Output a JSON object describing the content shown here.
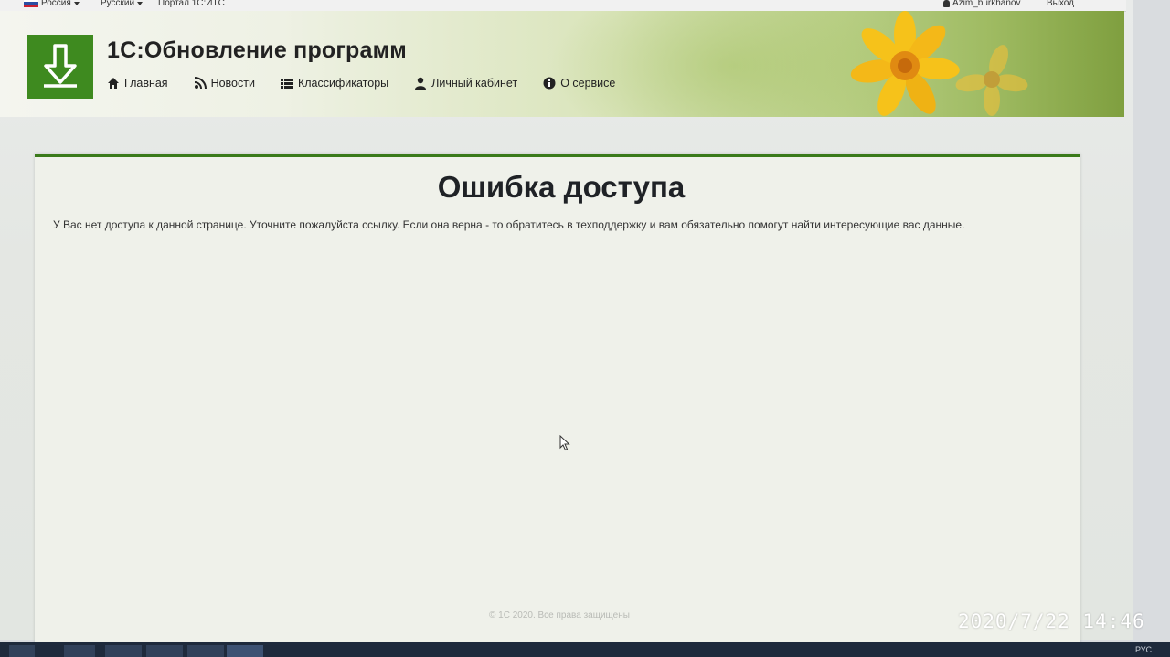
{
  "topbar": {
    "region": "Россия",
    "language": "Русский",
    "portal_link": "Портал 1С:ИТС",
    "user": "Azim_burkhanov",
    "logout": "Выход"
  },
  "header": {
    "title": "1С:Обновление программ",
    "nav": [
      {
        "label": "Главная",
        "icon": "home-icon"
      },
      {
        "label": "Новости",
        "icon": "rss-icon"
      },
      {
        "label": "Классификаторы",
        "icon": "list-icon"
      },
      {
        "label": "Личный кабинет",
        "icon": "user-icon"
      },
      {
        "label": "О сервисе",
        "icon": "info-icon"
      }
    ]
  },
  "content": {
    "heading": "Ошибка доступа",
    "message": "У Вас нет доступа к данной странице. Уточните пожалуйста ссылку. Если она верна - то обратитесь в техподдержку и вам обязательно помогут найти интересующие вас данные."
  },
  "footer": {
    "copyright": "© 1С 2020. Все права защищены"
  },
  "taskbar": {
    "lang": "РУС"
  },
  "photo_timestamp": "2020/7/22  14:46",
  "colors": {
    "brand_green": "#3e8a1f",
    "panel_border": "#3a7a1a",
    "flower_yellow": "#f6c21a"
  }
}
